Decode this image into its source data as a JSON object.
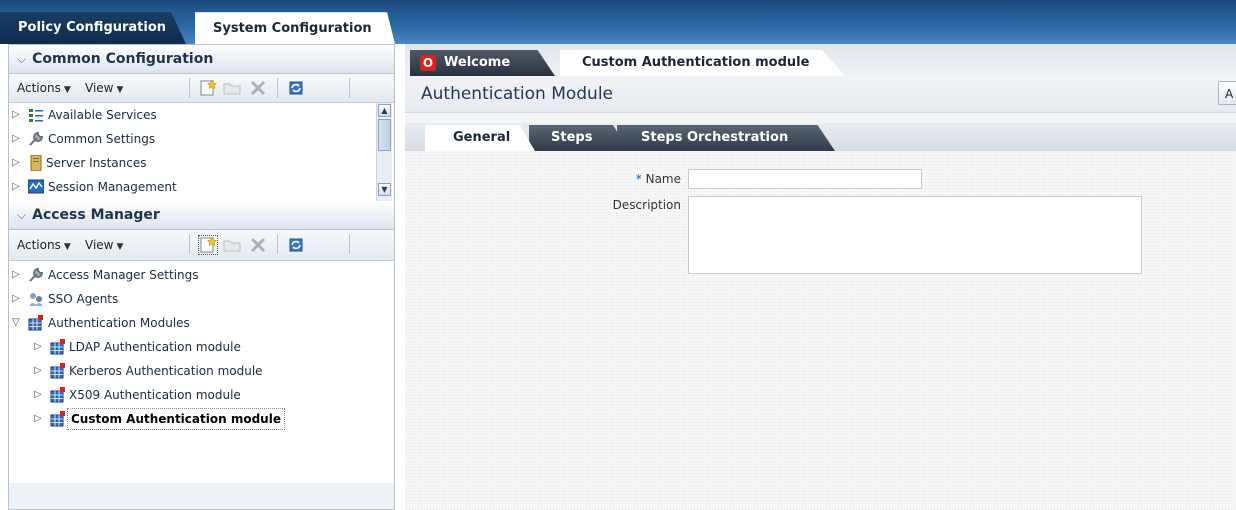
{
  "top_tabs": [
    {
      "label": "Policy Configuration",
      "active": false
    },
    {
      "label": "System Configuration",
      "active": true
    }
  ],
  "common_config": {
    "title": "Common Configuration",
    "toolbar": {
      "actions": "Actions",
      "view": "View"
    },
    "items": [
      {
        "label": "Available Services",
        "icon": "services-list-icon"
      },
      {
        "label": "Common Settings",
        "icon": "wrench-icon"
      },
      {
        "label": "Server Instances",
        "icon": "server-icon"
      },
      {
        "label": "Session Management",
        "icon": "session-monitor-icon"
      }
    ]
  },
  "access_manager": {
    "title": "Access Manager",
    "toolbar": {
      "actions": "Actions",
      "view": "View"
    },
    "items": [
      {
        "label": "Access Manager Settings",
        "icon": "wrench-icon"
      },
      {
        "label": "SSO Agents",
        "icon": "agents-icon"
      },
      {
        "label": "Authentication Modules",
        "icon": "module-grid-icon",
        "expanded": true,
        "children": [
          {
            "label": "LDAP Authentication module"
          },
          {
            "label": "Kerberos Authentication module"
          },
          {
            "label": "X509 Authentication module"
          },
          {
            "label": "Custom Authentication module",
            "selected": true
          }
        ]
      }
    ]
  },
  "page_tabs": [
    {
      "label": "Welcome",
      "active": false
    },
    {
      "label": "Custom Authentication module",
      "active": true
    }
  ],
  "page": {
    "title": "Authentication Module",
    "action_label": "A"
  },
  "sub_tabs": [
    {
      "label": "General",
      "active": true
    },
    {
      "label": "Steps",
      "active": false
    },
    {
      "label": "Steps Orchestration",
      "active": false
    }
  ],
  "form": {
    "name_required_mark": "*",
    "name_label": "Name",
    "name_value": "",
    "description_label": "Description",
    "description_value": ""
  },
  "colors": {
    "top_bar": "#2c6aa6",
    "oracle_red": "#d7231b",
    "title_blue": "#22375a"
  }
}
